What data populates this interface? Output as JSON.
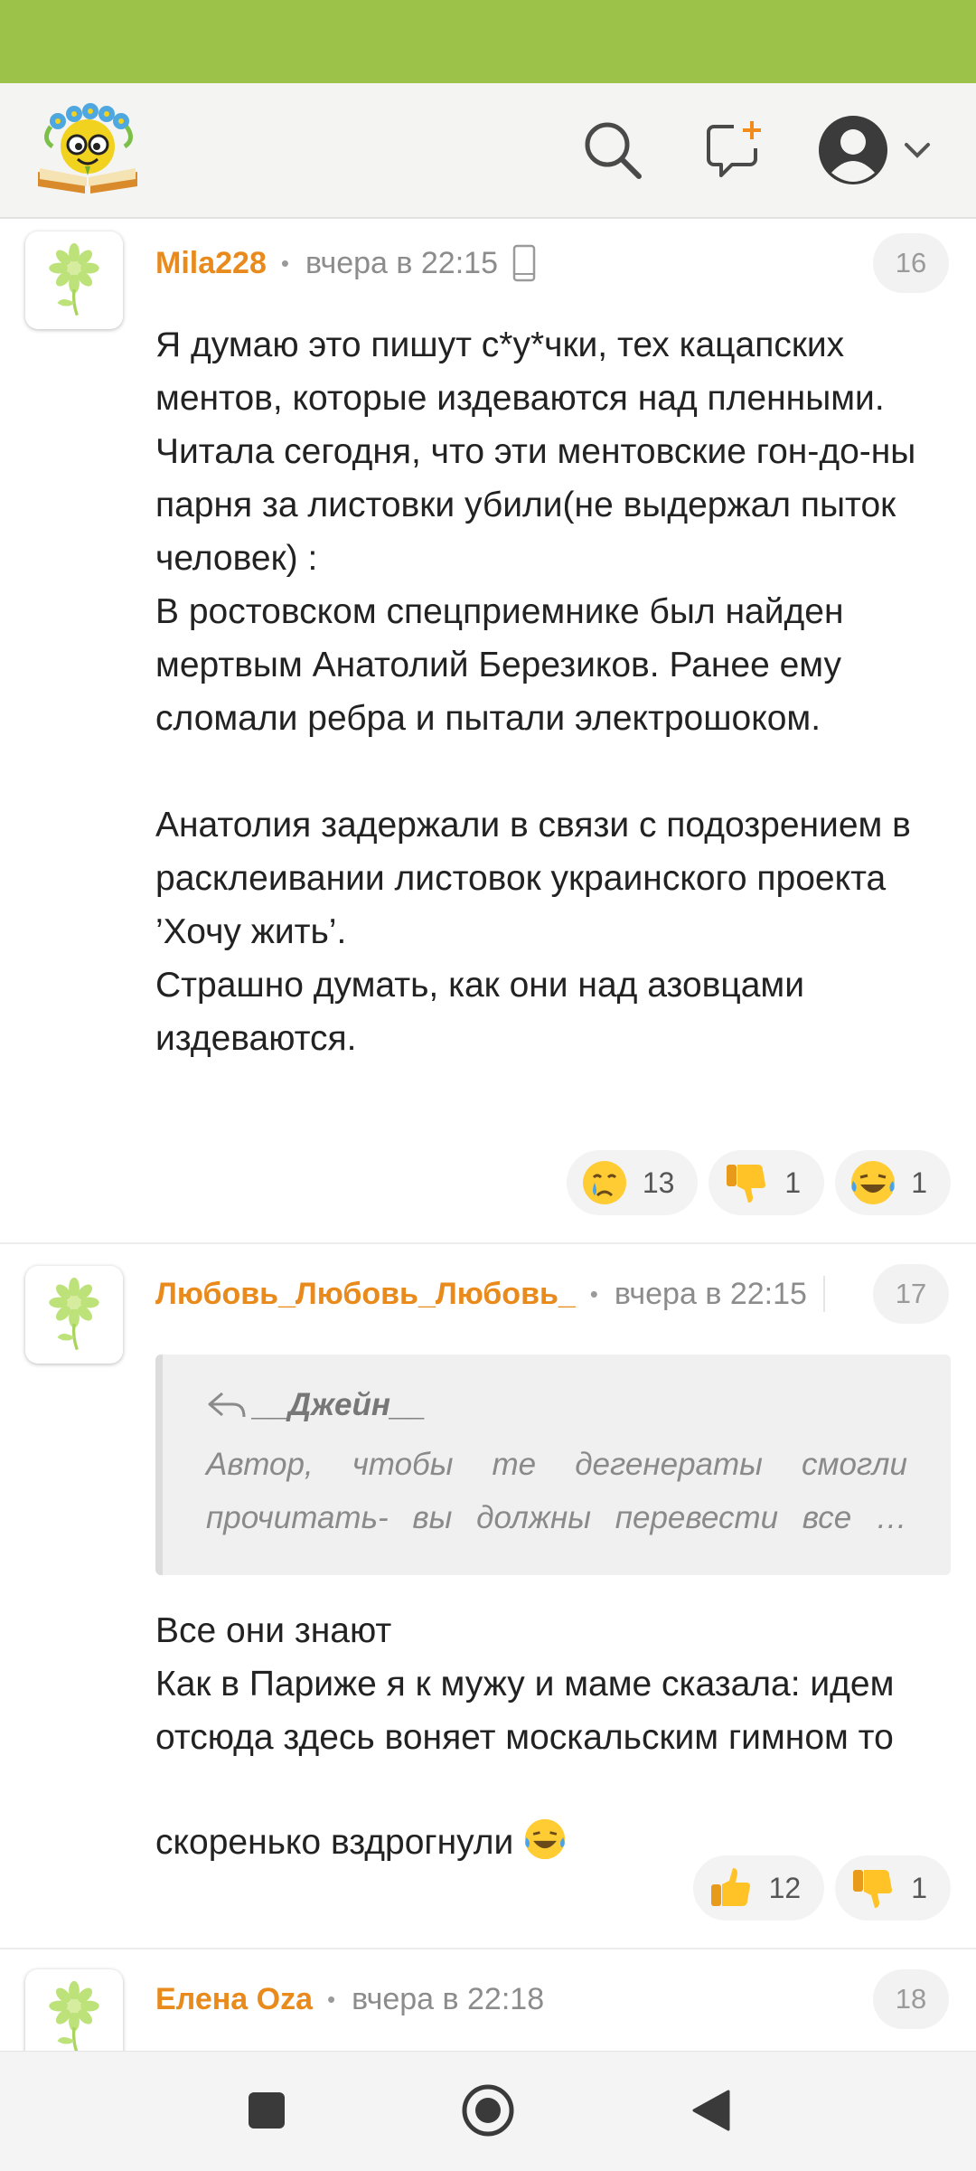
{
  "colors": {
    "status_bar": "#9cc24a",
    "author": "#e98a1c",
    "header_bg": "#f4f4f2"
  },
  "header": {
    "logo": "smiley-book-logo",
    "icons": [
      "search-icon",
      "new-message-icon",
      "profile-icon",
      "chevron-down-icon"
    ]
  },
  "comments": [
    {
      "author": "Mila228",
      "time": "вчера в 22:15",
      "device": "phone-icon",
      "number": "16",
      "paragraphs": [
        "Я думаю это пишут с*у*чки, тех кацапских ментов, которые издеваются над пленными.\nЧитала сегодня, что эти ментовские гон-до-ны парня за листовки убили(не выдержал пыток человек) :\nВ ростовском спецприемнике был найден мертвым Анатолий Березиков. Ранее ему сломали ребра и пытали электрошоком.",
        "Анатолия задержали в связи с подозрением в расклеивании листовок украинского проекта ’Хочу жить’.\nСтрашно думать, как они над азовцами издеваются."
      ],
      "reactions": [
        {
          "icon": "crying-emoji",
          "count": "13"
        },
        {
          "icon": "thumbs-down-emoji",
          "count": "1"
        },
        {
          "icon": "laughing-tears-emoji",
          "count": "1"
        }
      ]
    },
    {
      "author": "Любовь_Любовь_Любовь_",
      "time": "вчера в 22:15",
      "number": "17",
      "quote": {
        "author": "__Джейн__",
        "line1": "Автор, чтобы те дегенераты смогли",
        "line2": "прочитать- вы должны перевести все …"
      },
      "paragraphs": [
        "Все они знают\nКак в Париже я к мужу и маме сказала: идем отсюда здесь воняет москальским гимном то скоренько вздрогнули "
      ],
      "inline_emoji": "laughing-tears-emoji",
      "reactions": [
        {
          "icon": "thumbs-up-emoji",
          "count": "12"
        },
        {
          "icon": "thumbs-down-emoji",
          "count": "1"
        }
      ]
    },
    {
      "author": "Елена Oza",
      "time": "вчера в 22:18",
      "number": "18"
    }
  ],
  "nav_bar": {
    "icons": [
      "recent-apps-icon",
      "home-icon",
      "back-icon"
    ]
  }
}
